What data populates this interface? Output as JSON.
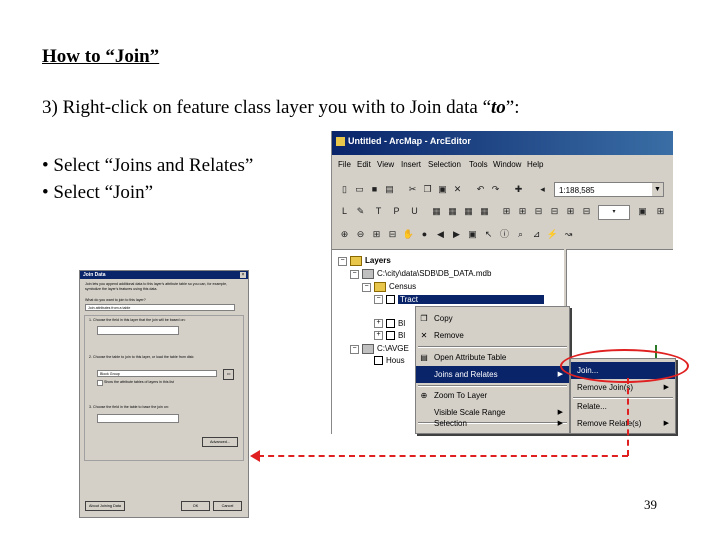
{
  "slide": {
    "title": "How to “Join”",
    "step_prefix": "3) Right-click on feature class layer you with to Join data “",
    "step_emph": "to",
    "step_suffix": "”:",
    "bullets": [
      "• Select “Joins and Relates”",
      "• Select “Join”"
    ],
    "page_number": "39"
  },
  "arcmap": {
    "title": "Untitled - ArcMap - ArcEditor",
    "menu": [
      "File",
      "Edit",
      "View",
      "Insert",
      "Selection",
      "Tools",
      "Window",
      "Help"
    ],
    "scale": "1:188,585",
    "toc": {
      "root": "Layers",
      "db": "C:\\city\\data\\SDB\\DB_DATA.mdb",
      "group": "Census",
      "selected_layer": "Tract",
      "other_prefix_1": "Bl",
      "other_prefix_2": "Bl",
      "db2": "C:\\AVGE",
      "layer2": "Hous"
    },
    "context_menu": [
      {
        "label": "Copy",
        "icon": "copy-icon"
      },
      {
        "label": "Remove",
        "icon": "remove-icon"
      },
      {
        "label": "Open Attribute Table",
        "icon": "table-icon"
      },
      {
        "label": "Joins and Relates",
        "icon": "",
        "highlighted": true,
        "submenu": true
      },
      {
        "label": "Zoom To Layer",
        "icon": "zoom-icon"
      },
      {
        "label": "Visible Scale Range",
        "icon": "",
        "submenu": true
      },
      {
        "label": "Selection",
        "icon": "",
        "submenu": true
      }
    ],
    "submenu": [
      {
        "label": "Join...",
        "highlighted": true
      },
      {
        "label": "Remove Join(s)",
        "submenu": true
      },
      {
        "label": "Relate..."
      },
      {
        "label": "Remove Relate(s)",
        "submenu": true
      }
    ]
  },
  "join_dialog": {
    "title": "Join Data",
    "intro": "Join lets you append additional data to this layer's attribute table so you can, for example, symbolize the layer's features using this data.",
    "question": "What do you want to join to this layer?",
    "join_type": "Join attributes from a table",
    "step1": "1. Choose the field in this layer that the join will be based on:",
    "step2": "2. Choose the table to join to this layer, or load the table from disk:",
    "table_value": "Block Group",
    "show_attr": "Show the attribute tables of layers in this list",
    "step3": "3. Choose the field in the table to base the join on:",
    "advanced": "Advanced...",
    "about": "About Joining Data",
    "ok": "OK",
    "cancel": "Cancel"
  },
  "colors": {
    "highlight": "#0a246a",
    "annotation": "#e02020",
    "chrome": "#d4d0c8"
  }
}
